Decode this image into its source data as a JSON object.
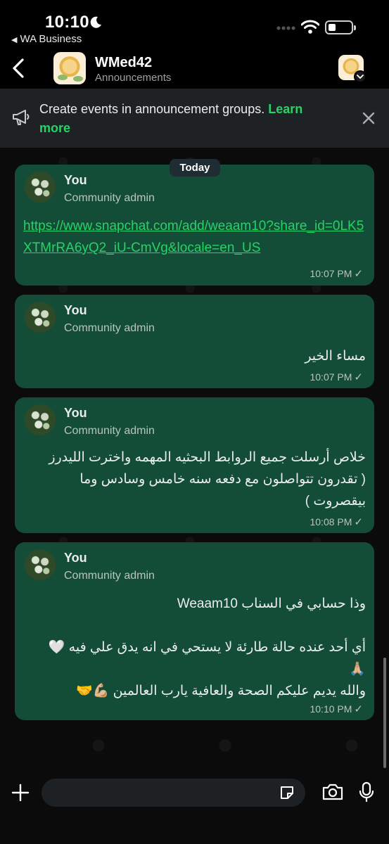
{
  "status_bar": {
    "time": "10:10",
    "back_app": "WA Business"
  },
  "header": {
    "title": "WMed42",
    "subtitle": "Announcements"
  },
  "banner": {
    "text": "Create events in announcement groups. ",
    "link": "Learn more"
  },
  "date_separator": "Today",
  "messages": [
    {
      "sender": "You",
      "role": "Community admin",
      "text": "https://www.snapchat.com/add/weaam10?share_id=0LK5XTMrRA6yQ2_iU-CmVg&locale=en_US",
      "time": "10:07 PM",
      "is_link": true
    },
    {
      "sender": "You",
      "role": "Community admin",
      "text": "مساء الخير",
      "time": "10:07 PM"
    },
    {
      "sender": "You",
      "role": "Community admin",
      "text_lines": [
        "خلاص أرسلت جميع الروابط البحثيه المهمه واخترت الليدرز",
        "( تقدرون تتواصلون مع دفعه سنه خامس وسادس وما",
        "بيقصروت )"
      ],
      "time": "10:08 PM"
    },
    {
      "sender": "You",
      "role": "Community admin",
      "text_lines": [
        "وذا حسابي في السناب Weaam10",
        "",
        "أي أحد عنده حالة طارئة لا يستحي في انه يدق علي فيه 🤍",
        "🙏🏼",
        "والله يديم عليكم الصحة والعافية يارب العالمين 💪🏼🤝"
      ],
      "time": "10:10 PM"
    }
  ],
  "composer": {
    "placeholder": ""
  },
  "icons": [
    "back-arrow-icon",
    "moon-icon",
    "wifi-icon",
    "battery-icon",
    "megaphone-icon",
    "close-icon",
    "plus-icon",
    "sticker-icon",
    "camera-icon",
    "mic-icon",
    "read-tick-icon"
  ],
  "colors": {
    "accent": "#25d366",
    "bubble": "#144d37",
    "banner": "#1f2224"
  }
}
